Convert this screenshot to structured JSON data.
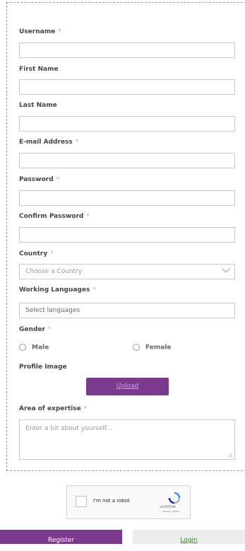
{
  "form": {
    "username": {
      "label": "Username",
      "required": "*"
    },
    "first_name": {
      "label": "First Name"
    },
    "last_name": {
      "label": "Last Name"
    },
    "email": {
      "label": "E-mail Address",
      "required": "*"
    },
    "password": {
      "label": "Password",
      "required": "*"
    },
    "confirm_password": {
      "label": "Confirm Password",
      "required": "*"
    },
    "country": {
      "label": "Country",
      "required": "*",
      "placeholder": "Choose a Country"
    },
    "working_languages": {
      "label": "Working Languages",
      "required": "*",
      "placeholder": "Select languages"
    },
    "gender": {
      "label": "Gender",
      "required": "*",
      "options": [
        "Male",
        "Female"
      ]
    },
    "profile_image": {
      "label": "Profile Image",
      "upload_label": "Upload"
    },
    "expertise": {
      "label": "Area of expertise",
      "required": "*",
      "placeholder": "Enter a bit about yourself..."
    }
  },
  "captcha": {
    "label": "I'm not a robot",
    "brand": "reCAPTCHA",
    "links": "Privacy - Terms"
  },
  "actions": {
    "register_label": "Register",
    "login_label": "Login"
  },
  "colors": {
    "brand_purple": "#7b3a8e",
    "login_green": "#2f8f1f",
    "required_mark": "#c8a0b4"
  },
  "icons": {
    "country_dropdown": "chevron-down-icon",
    "captcha_logo": "recaptcha-logo-icon",
    "textarea_resize": "resize-handle-icon"
  }
}
